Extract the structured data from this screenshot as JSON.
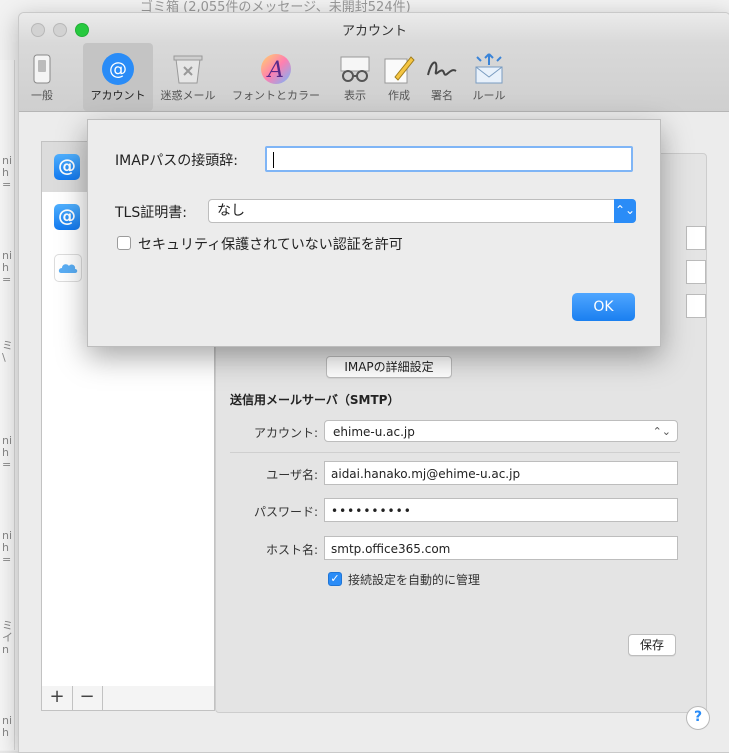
{
  "background": {
    "title_fragment": "ゴミ箱 (2,055件のメッセージ、未開封524件)"
  },
  "window": {
    "title": "アカウント"
  },
  "toolbar": {
    "items": [
      {
        "label": "一般",
        "icon": "general-switch-icon"
      },
      {
        "label": "アカウント",
        "icon": "at-sign-icon",
        "active": true
      },
      {
        "label": "迷惑メール",
        "icon": "trash-bin-icon"
      },
      {
        "label": "フォントとカラー",
        "icon": "font-color-icon"
      },
      {
        "label": "表示",
        "icon": "glasses-icon"
      },
      {
        "label": "作成",
        "icon": "pencil-icon"
      },
      {
        "label": "署名",
        "icon": "signature-icon"
      },
      {
        "label": "ルール",
        "icon": "rules-envelope-icon"
      }
    ]
  },
  "accounts": {
    "items": [
      {
        "icon": "at-sign-icon",
        "selected": true
      },
      {
        "icon": "at-sign-icon",
        "selected": false
      },
      {
        "icon": "icloud-icon",
        "selected": false
      }
    ],
    "add_label": "+",
    "remove_label": "−"
  },
  "panel": {
    "imap_advanced_button": "IMAPの詳細設定",
    "smtp_section_title": "送信用メールサーバ（SMTP）",
    "account_label": "アカウント:",
    "account_value": "ehime-u.ac.jp",
    "username_label": "ユーザ名:",
    "username_value": "aidai.hanako.mj@ehime-u.ac.jp",
    "password_label": "パスワード:",
    "password_value": "••••••••••",
    "host_label": "ホスト名:",
    "host_value": "smtp.office365.com",
    "auto_manage_label": "接続設定を自動的に管理",
    "auto_manage_checked": true,
    "save_button": "保存",
    "help_label": "?"
  },
  "sheet": {
    "imap_prefix_label": "IMAPパスの接頭辞:",
    "imap_prefix_value": "",
    "tls_label": "TLS証明書:",
    "tls_value": "なし",
    "allow_insecure_label": "セキュリティ保護されていない認証を許可",
    "allow_insecure_checked": false,
    "ok_button": "OK"
  },
  "colors": {
    "accent": "#2a8cf7",
    "traffic_green": "#27c93f"
  }
}
